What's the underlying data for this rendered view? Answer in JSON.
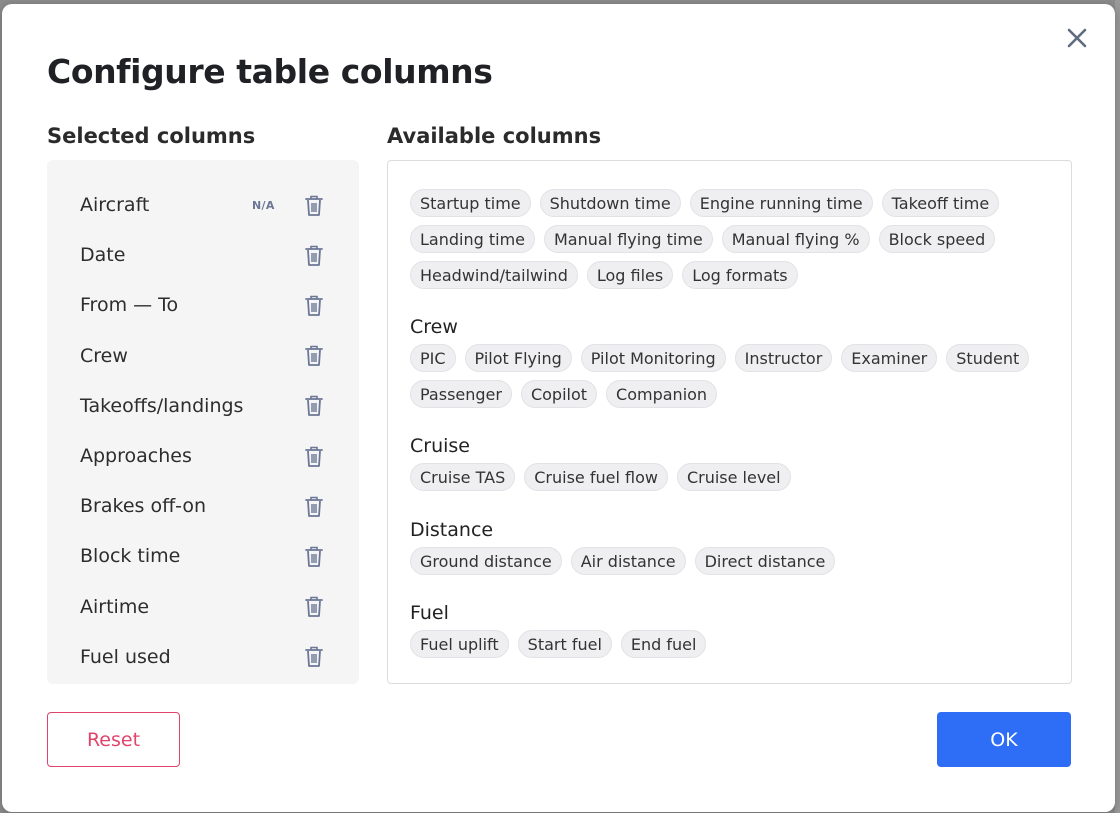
{
  "modal": {
    "title": "Configure table columns",
    "close_icon": "close-icon"
  },
  "selected": {
    "heading": "Selected columns",
    "items": [
      {
        "label": "Aircraft",
        "badge": "N/A"
      },
      {
        "label": "Date"
      },
      {
        "label": "From — To"
      },
      {
        "label": "Crew"
      },
      {
        "label": "Takeoffs/landings"
      },
      {
        "label": "Approaches"
      },
      {
        "label": "Brakes off-on"
      },
      {
        "label": "Block time"
      },
      {
        "label": "Airtime"
      },
      {
        "label": "Fuel used"
      }
    ],
    "remove_icon": "trash-icon"
  },
  "available": {
    "heading": "Available columns",
    "groups": [
      {
        "title": "",
        "chips": [
          "Startup time",
          "Shutdown time",
          "Engine running time",
          "Takeoff time",
          "Landing time",
          "Manual flying time",
          "Manual flying %",
          "Block speed",
          "Headwind/tailwind",
          "Log files",
          "Log formats"
        ]
      },
      {
        "title": "Crew",
        "chips": [
          "PIC",
          "Pilot Flying",
          "Pilot Monitoring",
          "Instructor",
          "Examiner",
          "Student",
          "Passenger",
          "Copilot",
          "Companion"
        ]
      },
      {
        "title": "Cruise",
        "chips": [
          "Cruise TAS",
          "Cruise fuel flow",
          "Cruise level"
        ]
      },
      {
        "title": "Distance",
        "chips": [
          "Ground distance",
          "Air distance",
          "Direct distance"
        ]
      },
      {
        "title": "Fuel",
        "chips": [
          "Fuel uplift",
          "Start fuel",
          "End fuel"
        ]
      }
    ]
  },
  "footer": {
    "reset_label": "Reset",
    "ok_label": "OK"
  },
  "colors": {
    "primary": "#2e6ef7",
    "danger": "#e0446b",
    "badge": "#6b7794"
  }
}
